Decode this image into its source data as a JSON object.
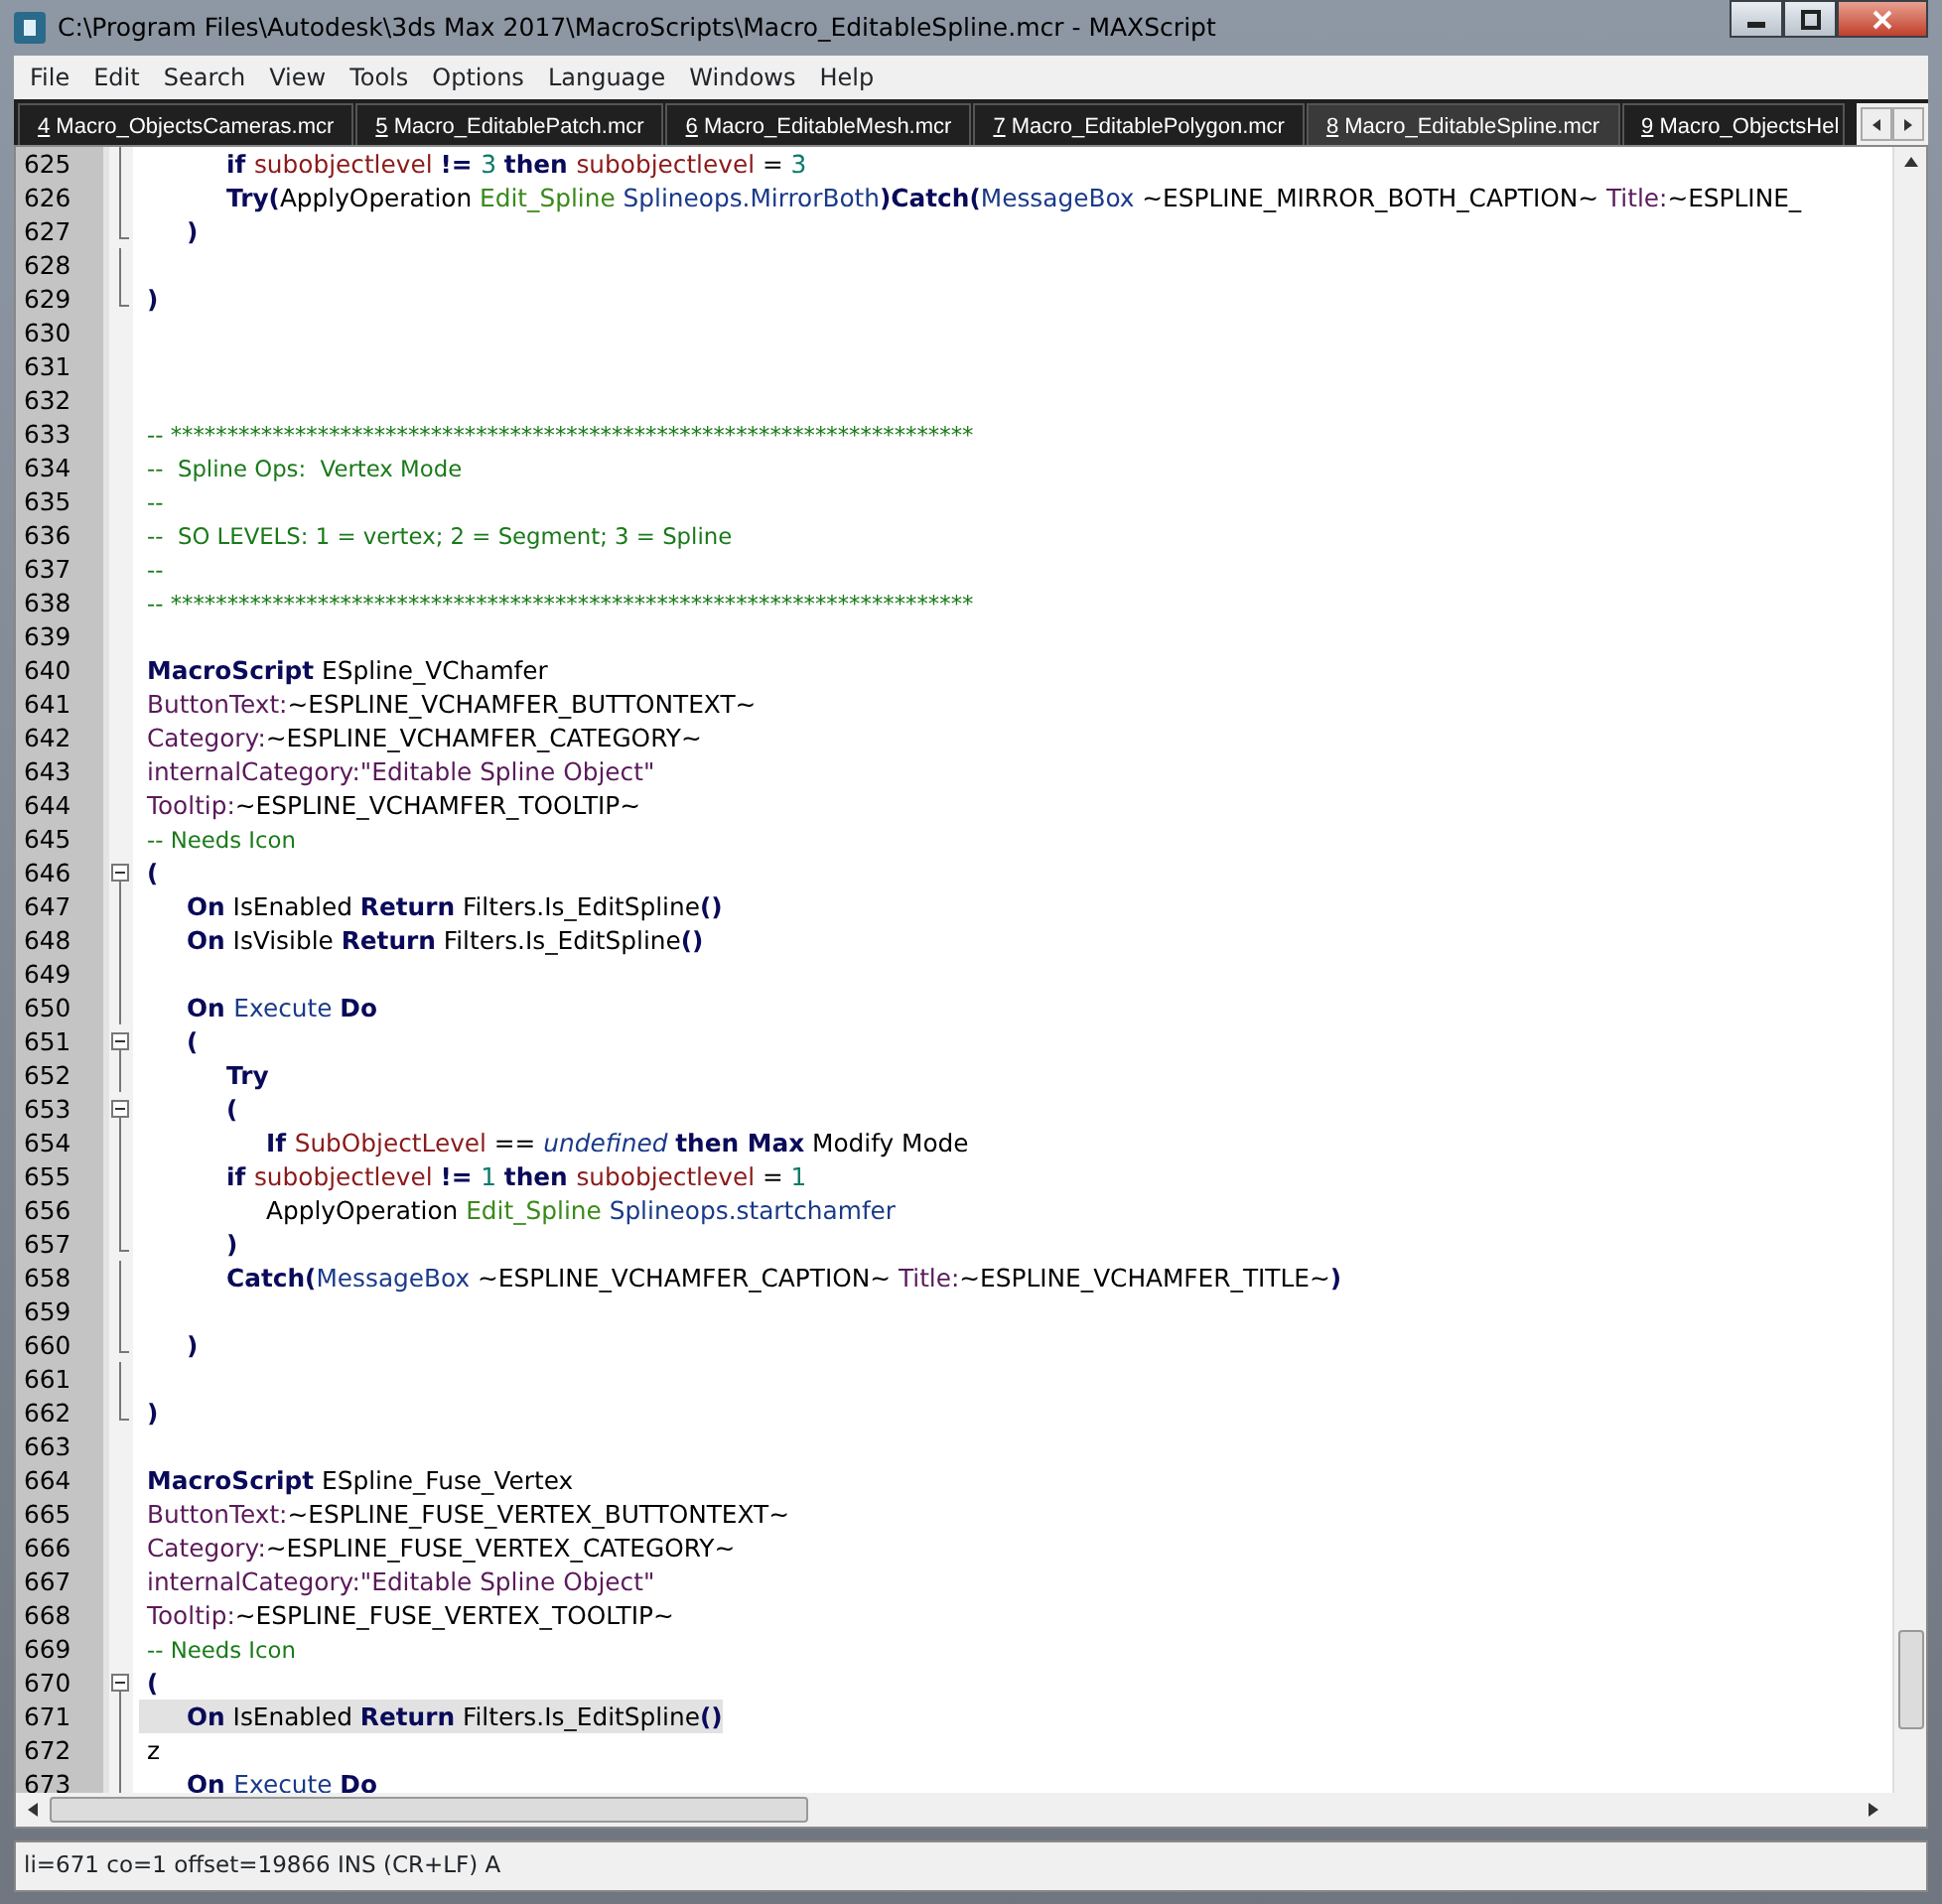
{
  "window": {
    "title": "C:\\Program Files\\Autodesk\\3ds Max 2017\\MacroScripts\\Macro_EditableSpline.mcr - MAXScript"
  },
  "menu": [
    "File",
    "Edit",
    "Search",
    "View",
    "Tools",
    "Options",
    "Language",
    "Windows",
    "Help"
  ],
  "tabs": [
    {
      "key": "4",
      "label": "Macro_ObjectsCameras.mcr",
      "selected": false
    },
    {
      "key": "5",
      "label": "Macro_EditablePatch.mcr",
      "selected": false
    },
    {
      "key": "6",
      "label": "Macro_EditableMesh.mcr",
      "selected": false
    },
    {
      "key": "7",
      "label": "Macro_EditablePolygon.mcr",
      "selected": false
    },
    {
      "key": "8",
      "label": "Macro_EditableSpline.mcr",
      "selected": true
    },
    {
      "key": "9",
      "label": "Macro_ObjectsHel",
      "selected": false
    }
  ],
  "lines": [
    {
      "number": "625",
      "kind": "foldbody",
      "current": false,
      "tokens": [
        {
          "kind": "kw",
          "text": "\t\tif "
        },
        {
          "kind": "var",
          "text": "subobjectlevel "
        },
        {
          "kind": "kw",
          "text": "!= "
        },
        {
          "kind": "num",
          "text": "3 "
        },
        {
          "kind": "kw",
          "text": "then "
        },
        {
          "kind": "var",
          "text": "subobjectlevel"
        },
        {
          "kind": "plain",
          "text": " = "
        },
        {
          "kind": "num",
          "text": "3"
        }
      ]
    },
    {
      "number": "626",
      "kind": "foldbody",
      "current": false,
      "tokens": [
        {
          "kind": "kw",
          "text": "\t\tTry("
        },
        {
          "kind": "plain",
          "text": "ApplyOperation "
        },
        {
          "kind": "fn",
          "text": "Edit_Spline "
        },
        {
          "kind": "cls",
          "text": "Splineops.MirrorBoth"
        },
        {
          "kind": "kw",
          "text": ")Catch("
        },
        {
          "kind": "cls",
          "text": "MessageBox"
        },
        {
          "kind": "plain",
          "text": " ~ESPLINE_MIRROR_BOTH_CAPTION~ "
        },
        {
          "kind": "prop",
          "text": "Title:"
        },
        {
          "kind": "plain",
          "text": "~ESPLINE_"
        }
      ]
    },
    {
      "number": "627",
      "kind": "foldend",
      "current": false,
      "tokens": [
        {
          "kind": "kw",
          "text": "\t)"
        }
      ]
    },
    {
      "number": "628",
      "kind": "foldbody",
      "current": false
    },
    {
      "number": "629",
      "kind": "foldend",
      "current": false,
      "tokens": [
        {
          "kind": "kw",
          "text": ")"
        }
      ]
    },
    {
      "number": "630",
      "kind": "plain",
      "current": false
    },
    {
      "number": "631",
      "kind": "plain",
      "current": false
    },
    {
      "number": "632",
      "kind": "plain",
      "current": false
    },
    {
      "number": "633",
      "kind": "plain",
      "current": false,
      "tokens": [
        {
          "kind": "comment",
          "text": "-- ***********************************************************************"
        }
      ]
    },
    {
      "number": "634",
      "kind": "plain",
      "current": false,
      "tokens": [
        {
          "kind": "comment",
          "text": "--  Spline Ops:  Vertex Mode"
        }
      ]
    },
    {
      "number": "635",
      "kind": "plain",
      "current": false,
      "tokens": [
        {
          "kind": "comment",
          "text": "--"
        }
      ]
    },
    {
      "number": "636",
      "kind": "plain",
      "current": false,
      "tokens": [
        {
          "kind": "comment",
          "text": "--  SO LEVELS: 1 = vertex; 2 = Segment; 3 = Spline"
        }
      ]
    },
    {
      "number": "637",
      "kind": "plain",
      "current": false,
      "tokens": [
        {
          "kind": "comment",
          "text": "--"
        }
      ]
    },
    {
      "number": "638",
      "kind": "plain",
      "current": false,
      "tokens": [
        {
          "kind": "comment",
          "text": "-- ***********************************************************************"
        }
      ]
    },
    {
      "number": "639",
      "kind": "plain",
      "current": false
    },
    {
      "number": "640",
      "kind": "plain",
      "current": false,
      "tokens": [
        {
          "kind": "kw",
          "text": "MacroScript"
        },
        {
          "kind": "plain",
          "text": " ESpline_VChamfer"
        }
      ]
    },
    {
      "number": "641",
      "kind": "plain",
      "current": false,
      "tokens": [
        {
          "kind": "prop",
          "text": "ButtonText:"
        },
        {
          "kind": "plain",
          "text": "~ESPLINE_VCHAMFER_BUTTONTEXT~"
        }
      ]
    },
    {
      "number": "642",
      "kind": "plain",
      "current": false,
      "tokens": [
        {
          "kind": "prop",
          "text": "Category:"
        },
        {
          "kind": "plain",
          "text": "~ESPLINE_VCHAMFER_CATEGORY~"
        }
      ]
    },
    {
      "number": "643",
      "kind": "plain",
      "current": false,
      "tokens": [
        {
          "kind": "prop",
          "text": "internalCategory:\"Editable Spline Object\""
        }
      ]
    },
    {
      "number": "644",
      "kind": "plain",
      "current": false,
      "tokens": [
        {
          "kind": "prop",
          "text": "Tooltip:"
        },
        {
          "kind": "plain",
          "text": "~ESPLINE_VCHAMFER_TOOLTIP~"
        }
      ]
    },
    {
      "number": "645",
      "kind": "plain",
      "current": false,
      "tokens": [
        {
          "kind": "comment",
          "text": "-- Needs Icon"
        }
      ]
    },
    {
      "number": "646",
      "kind": "foldstart",
      "current": false,
      "tokens": [
        {
          "kind": "kw",
          "text": "("
        }
      ]
    },
    {
      "number": "647",
      "kind": "foldbody",
      "current": false,
      "tokens": [
        {
          "kind": "kw",
          "text": "\tOn"
        },
        {
          "kind": "plain",
          "text": " IsEnabled "
        },
        {
          "kind": "kw",
          "text": "Return"
        },
        {
          "kind": "plain",
          "text": " Filters.Is_EditSpline"
        },
        {
          "kind": "kw",
          "text": "()"
        }
      ]
    },
    {
      "number": "648",
      "kind": "foldbody",
      "current": false,
      "tokens": [
        {
          "kind": "kw",
          "text": "\tOn"
        },
        {
          "kind": "plain",
          "text": " IsVisible "
        },
        {
          "kind": "kw",
          "text": "Return"
        },
        {
          "kind": "plain",
          "text": " Filters.Is_EditSpline"
        },
        {
          "kind": "kw",
          "text": "()"
        }
      ]
    },
    {
      "number": "649",
      "kind": "foldbody",
      "current": false
    },
    {
      "number": "650",
      "kind": "foldbody",
      "current": false,
      "tokens": [
        {
          "kind": "kw",
          "text": "\tOn "
        },
        {
          "kind": "cls",
          "text": "Execute "
        },
        {
          "kind": "kw",
          "text": "Do"
        }
      ]
    },
    {
      "number": "651",
      "kind": "foldstart",
      "current": false,
      "tokens": [
        {
          "kind": "kw",
          "text": "\t("
        }
      ]
    },
    {
      "number": "652",
      "kind": "foldbody",
      "current": false,
      "tokens": [
        {
          "kind": "kw",
          "text": "\t\tTry"
        }
      ]
    },
    {
      "number": "653",
      "kind": "foldstart",
      "current": false,
      "tokens": [
        {
          "kind": "kw",
          "text": "\t\t("
        }
      ]
    },
    {
      "number": "654",
      "kind": "foldbody",
      "current": false,
      "tokens": [
        {
          "kind": "kw",
          "text": "\t\t\tIf "
        },
        {
          "kind": "var",
          "text": "SubObjectLevel"
        },
        {
          "kind": "plain",
          "text": " == "
        },
        {
          "kind": "italic",
          "text": "undefined "
        },
        {
          "kind": "kw",
          "text": "then Max"
        },
        {
          "kind": "plain",
          "text": " Modify Mode"
        }
      ]
    },
    {
      "number": "655",
      "kind": "foldbody",
      "current": false,
      "tokens": [
        {
          "kind": "kw",
          "text": "\t\tif "
        },
        {
          "kind": "var",
          "text": "subobjectlevel "
        },
        {
          "kind": "kw",
          "text": "!= "
        },
        {
          "kind": "num",
          "text": "1 "
        },
        {
          "kind": "kw",
          "text": "then "
        },
        {
          "kind": "var",
          "text": "subobjectlevel"
        },
        {
          "kind": "plain",
          "text": " = "
        },
        {
          "kind": "num",
          "text": "1"
        }
      ]
    },
    {
      "number": "656",
      "kind": "foldbody",
      "current": false,
      "tokens": [
        {
          "kind": "plain",
          "text": "\t\t\tApplyOperation "
        },
        {
          "kind": "fn",
          "text": "Edit_Spline "
        },
        {
          "kind": "cls",
          "text": "Splineops.startchamfer"
        }
      ]
    },
    {
      "number": "657",
      "kind": "foldend",
      "current": false,
      "tokens": [
        {
          "kind": "kw",
          "text": "\t\t)"
        }
      ]
    },
    {
      "number": "658",
      "kind": "foldbody",
      "current": false,
      "tokens": [
        {
          "kind": "kw",
          "text": "\t\tCatch("
        },
        {
          "kind": "cls",
          "text": "MessageBox"
        },
        {
          "kind": "plain",
          "text": " ~ESPLINE_VCHAMFER_CAPTION~ "
        },
        {
          "kind": "prop",
          "text": "Title:"
        },
        {
          "kind": "plain",
          "text": "~ESPLINE_VCHAMFER_TITLE~"
        },
        {
          "kind": "kw",
          "text": ")"
        }
      ]
    },
    {
      "number": "659",
      "kind": "foldbody",
      "current": false
    },
    {
      "number": "660",
      "kind": "foldend",
      "current": false,
      "tokens": [
        {
          "kind": "kw",
          "text": "\t)"
        }
      ]
    },
    {
      "number": "661",
      "kind": "foldbody",
      "current": false
    },
    {
      "number": "662",
      "kind": "foldend",
      "current": false,
      "tokens": [
        {
          "kind": "kw",
          "text": ")"
        }
      ]
    },
    {
      "number": "663",
      "kind": "plain",
      "current": false
    },
    {
      "number": "664",
      "kind": "plain",
      "current": false,
      "tokens": [
        {
          "kind": "kw",
          "text": "MacroScript"
        },
        {
          "kind": "plain",
          "text": " ESpline_Fuse_Vertex"
        }
      ]
    },
    {
      "number": "665",
      "kind": "plain",
      "current": false,
      "tokens": [
        {
          "kind": "prop",
          "text": "ButtonText:"
        },
        {
          "kind": "plain",
          "text": "~ESPLINE_FUSE_VERTEX_BUTTONTEXT~"
        }
      ]
    },
    {
      "number": "666",
      "kind": "plain",
      "current": false,
      "tokens": [
        {
          "kind": "prop",
          "text": "Category:"
        },
        {
          "kind": "plain",
          "text": "~ESPLINE_FUSE_VERTEX_CATEGORY~"
        }
      ]
    },
    {
      "number": "667",
      "kind": "plain",
      "current": false,
      "tokens": [
        {
          "kind": "prop",
          "text": "internalCategory:\"Editable Spline Object\""
        }
      ]
    },
    {
      "number": "668",
      "kind": "plain",
      "current": false,
      "tokens": [
        {
          "kind": "prop",
          "text": "Tooltip:"
        },
        {
          "kind": "plain",
          "text": "~ESPLINE_FUSE_VERTEX_TOOLTIP~"
        }
      ]
    },
    {
      "number": "669",
      "kind": "plain",
      "current": false,
      "tokens": [
        {
          "kind": "comment",
          "text": "-- Needs Icon"
        }
      ]
    },
    {
      "number": "670",
      "kind": "foldstart",
      "current": false,
      "tokens": [
        {
          "kind": "kw",
          "text": "("
        }
      ]
    },
    {
      "number": "671",
      "kind": "foldbody",
      "current": true,
      "tokens": [
        {
          "kind": "kw",
          "text": "\tOn"
        },
        {
          "kind": "plain",
          "text": " IsEnabled "
        },
        {
          "kind": "kw",
          "text": "Return"
        },
        {
          "kind": "plain",
          "text": " Filters.Is_EditSpline"
        },
        {
          "kind": "kw",
          "text": "()"
        }
      ]
    },
    {
      "number": "672",
      "kind": "foldbody",
      "current": false,
      "tokens": [
        {
          "kind": "plain",
          "text": "z"
        }
      ]
    },
    {
      "number": "673",
      "kind": "foldbody",
      "current": false,
      "tokens": [
        {
          "kind": "kw",
          "text": "\tOn "
        },
        {
          "kind": "cls",
          "text": "Execute "
        },
        {
          "kind": "kw",
          "text": "Do"
        }
      ]
    }
  ],
  "status_bar": "li=671 co=1 offset=19866 INS (CR+LF) A"
}
